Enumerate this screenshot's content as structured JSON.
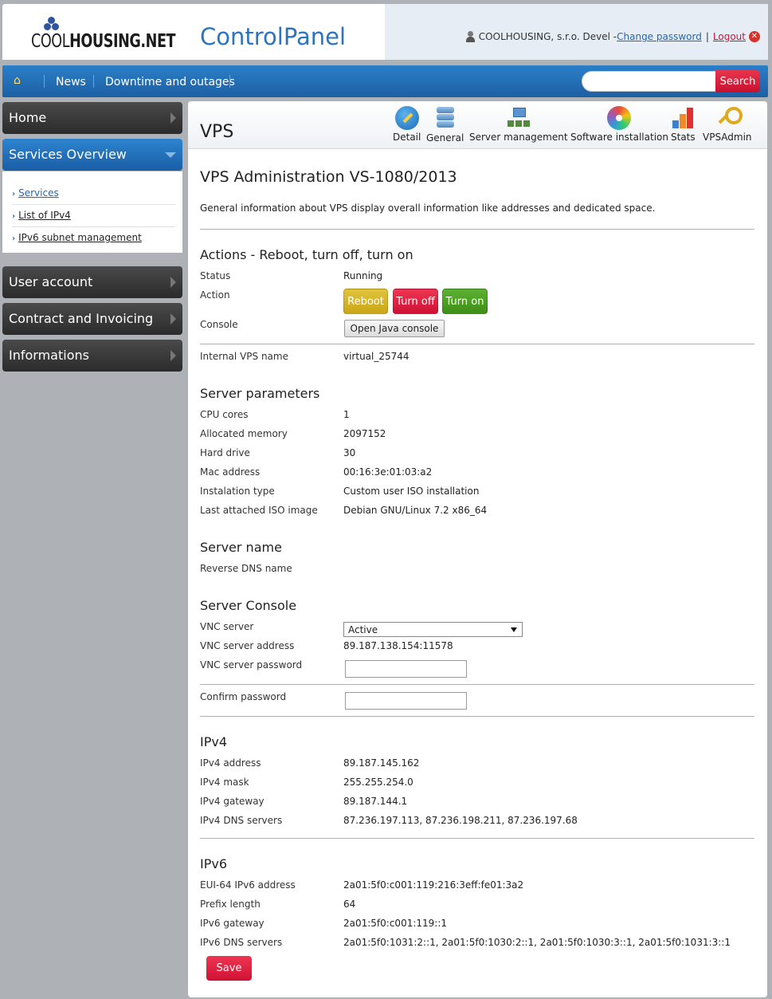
{
  "header": {
    "logo_text_light": "COOL",
    "logo_text_bold": "HOUSING.NET",
    "app_title": "ControlPanel",
    "user_name": "COOLHOUSING, s.r.o. Devel -",
    "change_password": "Change password",
    "separator": "|",
    "logout": "Logout"
  },
  "nav": {
    "home_icon": "home-icon",
    "news": "News",
    "downtime": "Downtime and outages",
    "search_placeholder": "",
    "search_button": "Search"
  },
  "sidebar": {
    "home": "Home",
    "services_overview": "Services Overview",
    "sub_items": [
      "Services",
      "List of IPv4",
      "IPv6 subnet management"
    ],
    "user_account": "User account",
    "contract": "Contract and Invoicing",
    "informations": "Informations"
  },
  "toolbar": {
    "page_title": "VPS",
    "detail": "Detail",
    "general": "General",
    "server_management": "Server management",
    "software_installation": "Software installation",
    "stats": "Stats",
    "vpsadmin": "VPSAdmin"
  },
  "main": {
    "heading": "VPS Administration VS-1080/2013",
    "intro": "General information about VPS display overall information like addresses and dedicated space.",
    "actions": {
      "title": "Actions - Reboot, turn off, turn on",
      "status_label": "Status",
      "status_value": "Running",
      "action_label": "Action",
      "reboot": "Reboot",
      "turn_off": "Turn off",
      "turn_on": "Turn on",
      "console_label": "Console",
      "java_console": "Open Java console",
      "internal_name_label": "Internal VPS name",
      "internal_name_value": "virtual_25744"
    },
    "server_params": {
      "title": "Server parameters",
      "cpu_label": "CPU cores",
      "cpu_value": "1",
      "mem_label": "Allocated memory",
      "mem_value": "2097152",
      "hdd_label": "Hard drive",
      "hdd_value": "30",
      "mac_label": "Mac address",
      "mac_value": "00:16:3e:01:03:a2",
      "inst_label": "Instalation type",
      "inst_value": "Custom user ISO installation",
      "iso_label": "Last attached ISO image",
      "iso_value": "Debian GNU/Linux 7.2 x86_64"
    },
    "server_name": {
      "title": "Server name",
      "rdns_label": "Reverse DNS name",
      "rdns_value": ""
    },
    "console": {
      "title": "Server Console",
      "vnc_label": "VNC server",
      "vnc_value": "Active",
      "vnc_addr_label": "VNC server address",
      "vnc_addr_value": "89.187.138.154:11578",
      "vnc_pw_label": "VNC server password",
      "confirm_label": "Confirm password"
    },
    "ipv4": {
      "title": "IPv4",
      "addr_label": "IPv4 address",
      "addr_value": "89.187.145.162",
      "mask_label": "IPv4 mask",
      "mask_value": "255.255.254.0",
      "gw_label": "IPv4 gateway",
      "gw_value": "89.187.144.1",
      "dns_label": "IPv4 DNS servers",
      "dns_value": "87.236.197.113, 87.236.198.211, 87.236.197.68"
    },
    "ipv6": {
      "title": "IPv6",
      "eui_label": "EUI-64 IPv6 address",
      "eui_value": "2a01:5f0:c001:119:216:3eff:fe01:3a2",
      "prefix_label": "Prefix length",
      "prefix_value": "64",
      "gw_label": "IPv6 gateway",
      "gw_value": "2a01:5f0:c001:119::1",
      "dns_label": "IPv6 DNS servers",
      "dns_value": "2a01:5f0:1031:2::1, 2a01:5f0:1030:2::1, 2a01:5f0:1030:3::1, 2a01:5f0:1031:3::1"
    },
    "save": "Save"
  },
  "colors": {
    "brand_blue": "#2b74c0",
    "nav_blue": "#1d5fa3",
    "red_button": "#cf1234",
    "yellow_button": "#c9a718",
    "green_button": "#3d8f16"
  }
}
